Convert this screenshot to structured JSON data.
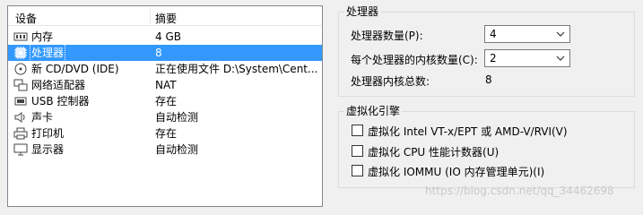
{
  "device_list": {
    "headers": {
      "device": "设备",
      "summary": "摘要"
    },
    "selected_index": 1,
    "rows": [
      {
        "icon": "memory-icon",
        "name": "内存",
        "summary": "4 GB"
      },
      {
        "icon": "processor-icon",
        "name": "处理器",
        "summary": "8"
      },
      {
        "icon": "cd-dvd-icon",
        "name": "新 CD/DVD (IDE)",
        "summary": "正在使用文件 D:\\System\\Cent..."
      },
      {
        "icon": "network-adapter-icon",
        "name": "网络适配器",
        "summary": "NAT"
      },
      {
        "icon": "usb-controller-icon",
        "name": "USB 控制器",
        "summary": "存在"
      },
      {
        "icon": "sound-card-icon",
        "name": "声卡",
        "summary": "自动检测"
      },
      {
        "icon": "printer-icon",
        "name": "打印机",
        "summary": "存在"
      },
      {
        "icon": "display-icon",
        "name": "显示器",
        "summary": "自动检测"
      }
    ]
  },
  "processors": {
    "title": "处理器",
    "count_label": "处理器数量(P):",
    "count_value": "4",
    "cores_label": "每个处理器的内核数量(C):",
    "cores_value": "2",
    "total_label": "处理器内核总数:",
    "total_value": "8"
  },
  "virtualization": {
    "title": "虚拟化引擎",
    "options": [
      {
        "label": "虚拟化 Intel VT-x/EPT 或 AMD-V/RVI(V)",
        "checked": false
      },
      {
        "label": "虚拟化 CPU 性能计数器(U)",
        "checked": false
      },
      {
        "label": "虚拟化 IOMMU (IO 内存管理单元)(I)",
        "checked": false
      }
    ]
  },
  "watermark": "https://blog.csdn.net/qq_34462698",
  "colors": {
    "selection": "#3399ff",
    "panel_bg": "#f0f0f0"
  }
}
